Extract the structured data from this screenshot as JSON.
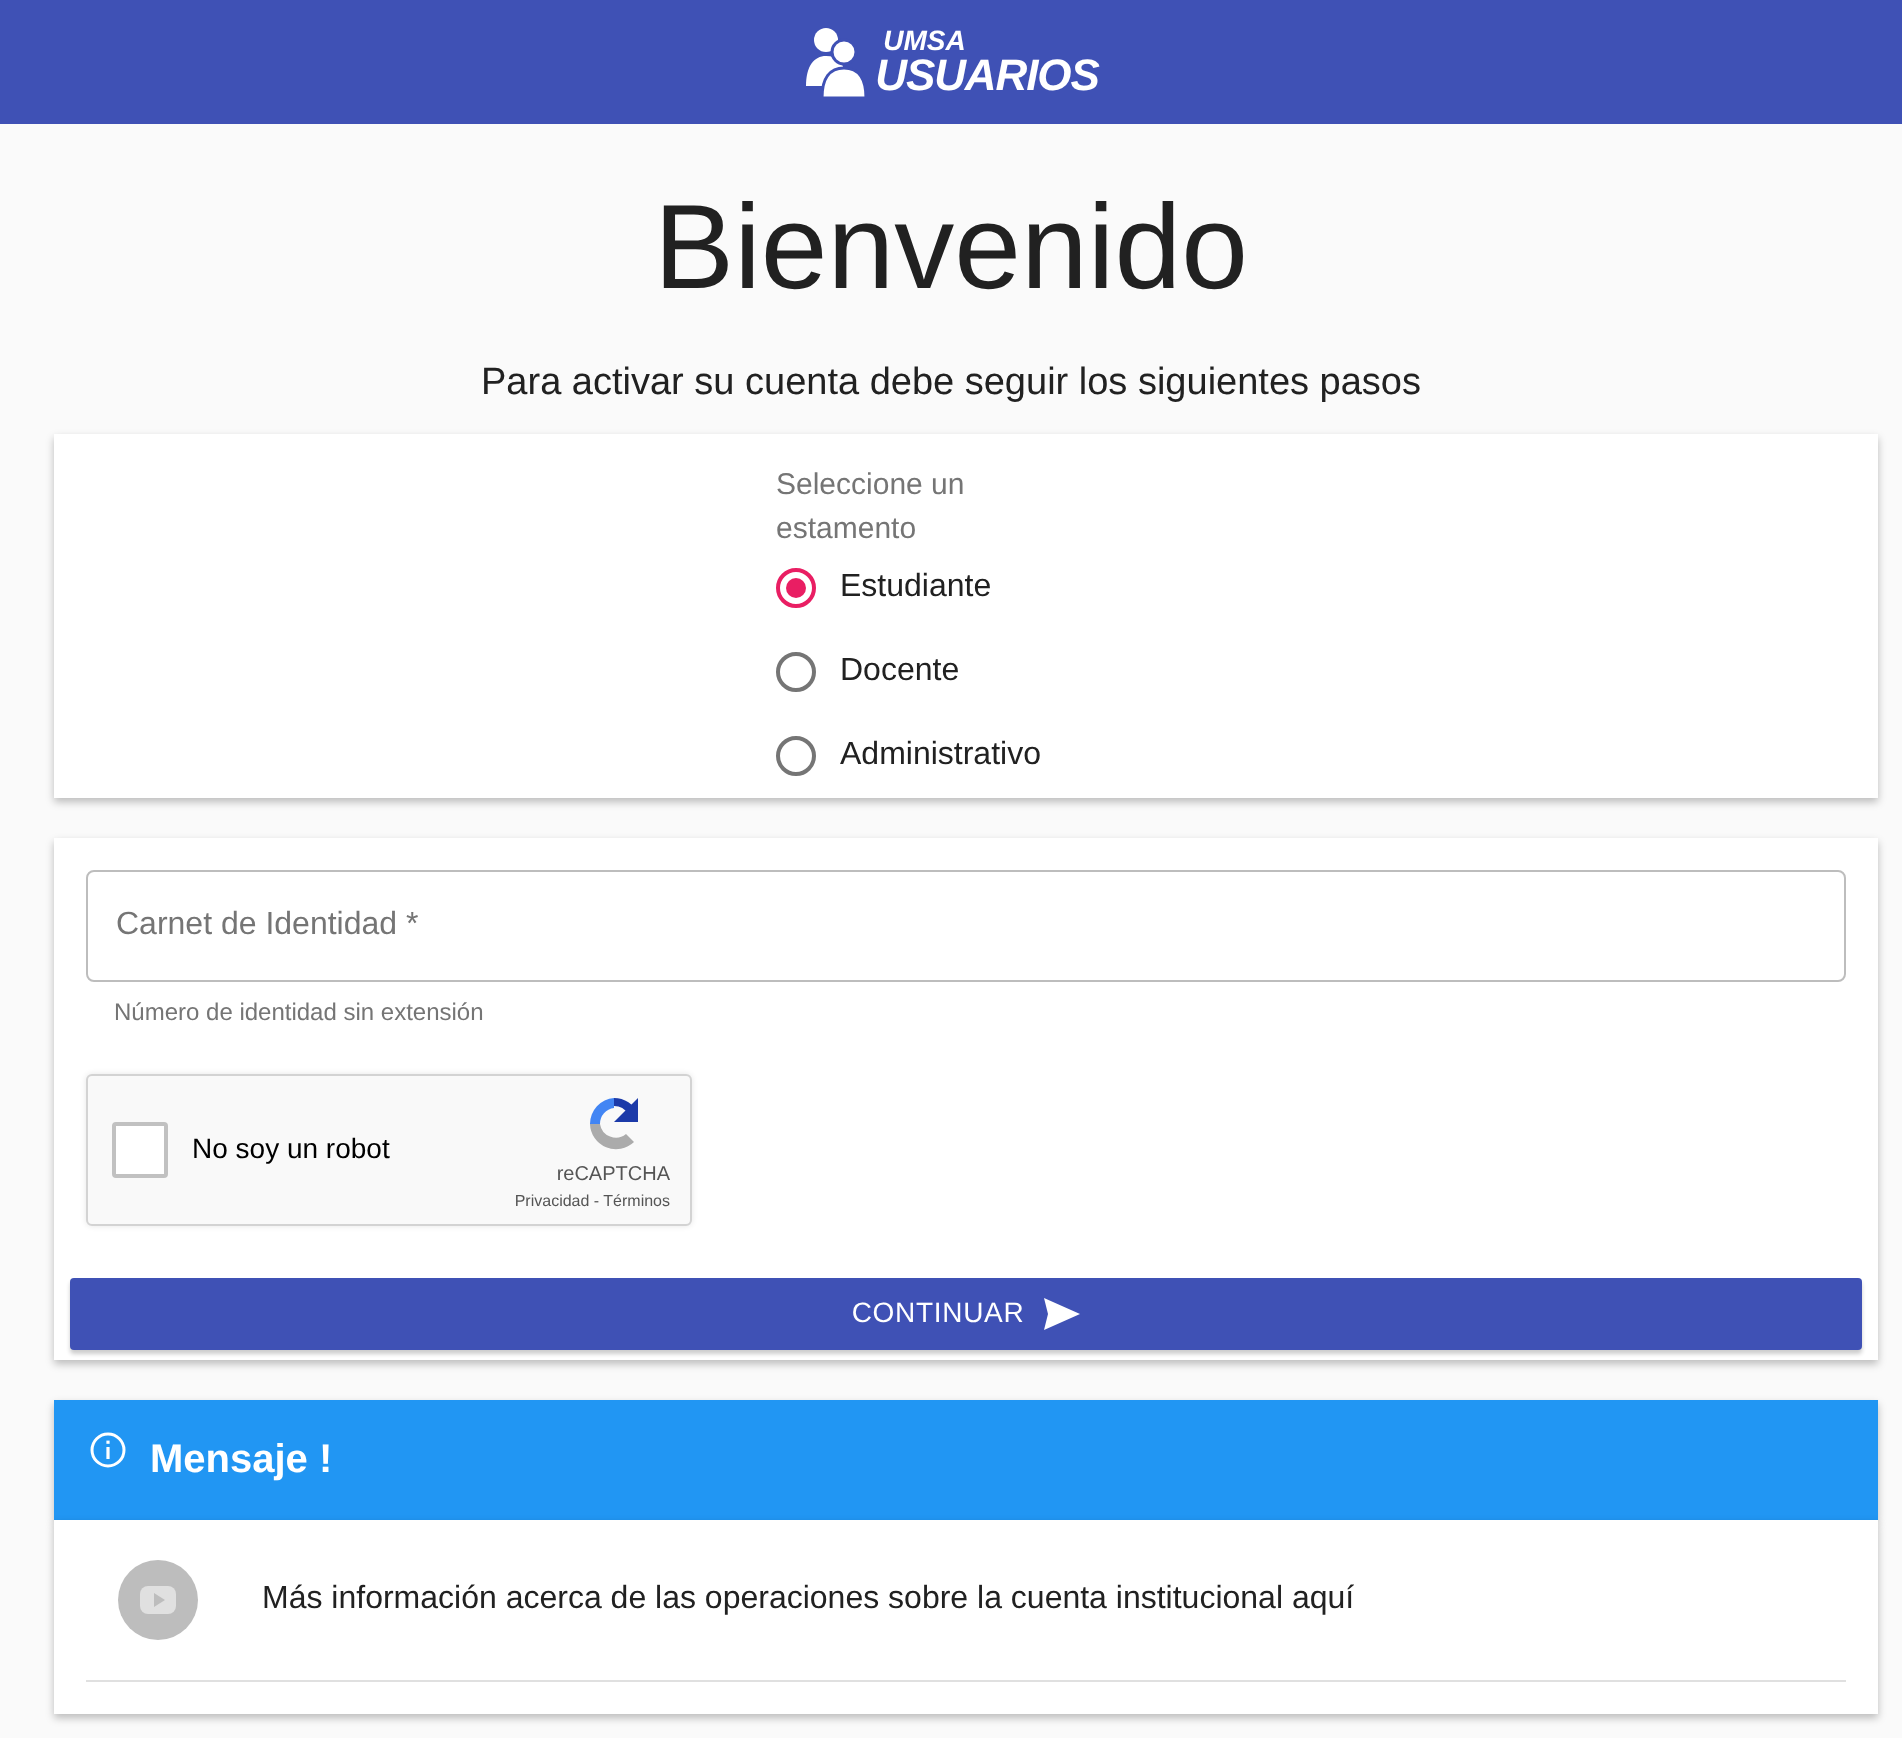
{
  "header": {
    "logo_top": "UMSA",
    "logo_bottom": "USUARIOS"
  },
  "title": "Bienvenido",
  "subtitle": "Para activar su cuenta debe seguir los siguientes pasos",
  "estamento": {
    "label": "Seleccione un estamento",
    "options": [
      {
        "label": "Estudiante",
        "selected": true
      },
      {
        "label": "Docente",
        "selected": false
      },
      {
        "label": "Administrativo",
        "selected": false
      }
    ]
  },
  "form": {
    "field": {
      "label": "Carnet de Identidad *",
      "hint": "Número de identidad sin extensión"
    },
    "captcha": {
      "label": "No soy un robot",
      "checked": false,
      "brand": "reCAPTCHA",
      "links": "Privacidad - Términos"
    },
    "button": "CONTINUAR"
  },
  "message": {
    "title": "Mensaje !",
    "items": [
      {
        "text": "Más información acerca de las operaciones sobre la cuenta institucional aquí"
      }
    ]
  }
}
